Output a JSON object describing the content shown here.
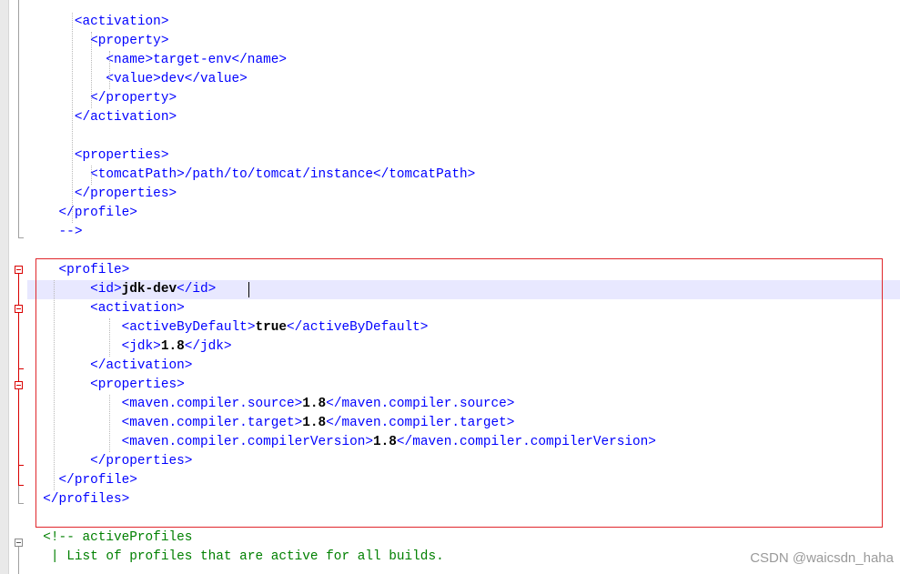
{
  "editor": {
    "lines": [
      {
        "indent": 6,
        "tokens": [
          {
            "t": "tag",
            "v": "<activation>"
          }
        ]
      },
      {
        "indent": 8,
        "tokens": [
          {
            "t": "tag",
            "v": "<property>"
          }
        ]
      },
      {
        "indent": 10,
        "tokens": [
          {
            "t": "tag",
            "v": "<name>target-env</name>"
          }
        ]
      },
      {
        "indent": 10,
        "tokens": [
          {
            "t": "tag",
            "v": "<value>dev</value>"
          }
        ]
      },
      {
        "indent": 8,
        "tokens": [
          {
            "t": "tag",
            "v": "</property>"
          }
        ]
      },
      {
        "indent": 6,
        "tokens": [
          {
            "t": "tag",
            "v": "</activation>"
          }
        ]
      },
      {
        "indent": 0,
        "tokens": []
      },
      {
        "indent": 6,
        "tokens": [
          {
            "t": "tag",
            "v": "<properties>"
          }
        ]
      },
      {
        "indent": 8,
        "tokens": [
          {
            "t": "tag",
            "v": "<tomcatPath>/path/to/tomcat/instance</tomcatPath>"
          }
        ]
      },
      {
        "indent": 6,
        "tokens": [
          {
            "t": "tag",
            "v": "</properties>"
          }
        ]
      },
      {
        "indent": 4,
        "tokens": [
          {
            "t": "tag",
            "v": "</profile>"
          }
        ]
      },
      {
        "indent": 4,
        "tokens": [
          {
            "t": "tag",
            "v": "-->"
          }
        ]
      },
      {
        "indent": 0,
        "tokens": []
      },
      {
        "indent": 4,
        "tokens": [
          {
            "t": "tag",
            "v": "<profile>"
          }
        ]
      },
      {
        "indent": 8,
        "tokens": [
          {
            "t": "tag",
            "v": "<id>"
          },
          {
            "t": "text",
            "v": "jdk-dev"
          },
          {
            "t": "tag",
            "v": "</id>"
          }
        ]
      },
      {
        "indent": 8,
        "tokens": [
          {
            "t": "tag",
            "v": "<activation>"
          }
        ]
      },
      {
        "indent": 12,
        "tokens": [
          {
            "t": "tag",
            "v": "<activeByDefault>"
          },
          {
            "t": "text",
            "v": "true"
          },
          {
            "t": "tag",
            "v": "</activeByDefault>"
          }
        ]
      },
      {
        "indent": 12,
        "tokens": [
          {
            "t": "tag",
            "v": "<jdk>"
          },
          {
            "t": "text",
            "v": "1.8"
          },
          {
            "t": "tag",
            "v": "</jdk>"
          }
        ]
      },
      {
        "indent": 8,
        "tokens": [
          {
            "t": "tag",
            "v": "</activation>"
          }
        ]
      },
      {
        "indent": 8,
        "tokens": [
          {
            "t": "tag",
            "v": "<properties>"
          }
        ]
      },
      {
        "indent": 12,
        "tokens": [
          {
            "t": "tag",
            "v": "<maven.compiler.source>"
          },
          {
            "t": "text",
            "v": "1.8"
          },
          {
            "t": "tag",
            "v": "</maven.compiler.source>"
          }
        ]
      },
      {
        "indent": 12,
        "tokens": [
          {
            "t": "tag",
            "v": "<maven.compiler.target>"
          },
          {
            "t": "text",
            "v": "1.8"
          },
          {
            "t": "tag",
            "v": "</maven.compiler.target>"
          }
        ]
      },
      {
        "indent": 12,
        "tokens": [
          {
            "t": "tag",
            "v": "<maven.compiler.compilerVersion>"
          },
          {
            "t": "text",
            "v": "1.8"
          },
          {
            "t": "tag",
            "v": "</maven.compiler.compilerVersion>"
          }
        ]
      },
      {
        "indent": 8,
        "tokens": [
          {
            "t": "tag",
            "v": "</properties>"
          }
        ]
      },
      {
        "indent": 4,
        "tokens": [
          {
            "t": "tag",
            "v": "</profile>"
          }
        ]
      },
      {
        "indent": 2,
        "tokens": [
          {
            "t": "tag",
            "v": "</profiles>"
          }
        ]
      },
      {
        "indent": 0,
        "tokens": []
      },
      {
        "indent": 2,
        "tokens": [
          {
            "t": "comment",
            "v": "<!-- activeProfiles"
          }
        ]
      },
      {
        "indent": 3,
        "tokens": [
          {
            "t": "comment",
            "v": "| List of profiles that are active for all builds."
          }
        ]
      }
    ],
    "current_line": 14
  },
  "colors": {
    "tag": "#0000ff",
    "text": "#000000",
    "comment": "#008000",
    "current_line_bg": "#e8e8ff",
    "fold_marker": "#d90000",
    "highlight_box": "#e0262b"
  },
  "watermark": {
    "text": "CSDN @waicsdn_haha"
  }
}
